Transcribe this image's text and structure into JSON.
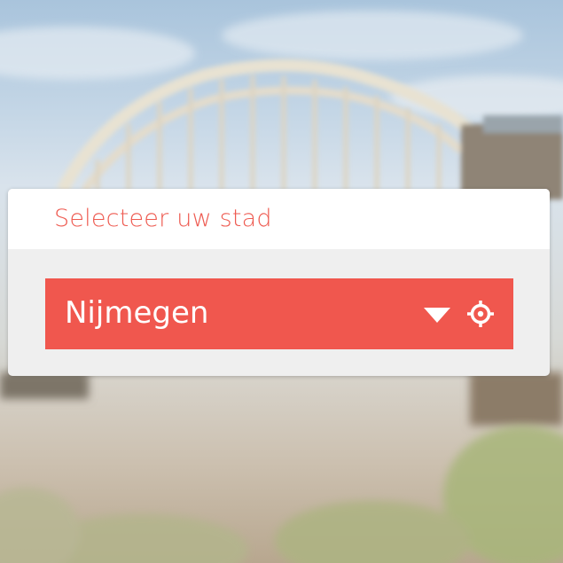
{
  "city_selector": {
    "title": "Selecteer uw stad",
    "selected_city": "Nijmegen",
    "dropdown_icon": "chevron-down-icon",
    "locate_icon": "crosshair-locate-icon"
  },
  "colors": {
    "accent": "#f0574e",
    "title_text": "#ee5a50",
    "card_background": "#efefef",
    "header_background": "#ffffff"
  }
}
